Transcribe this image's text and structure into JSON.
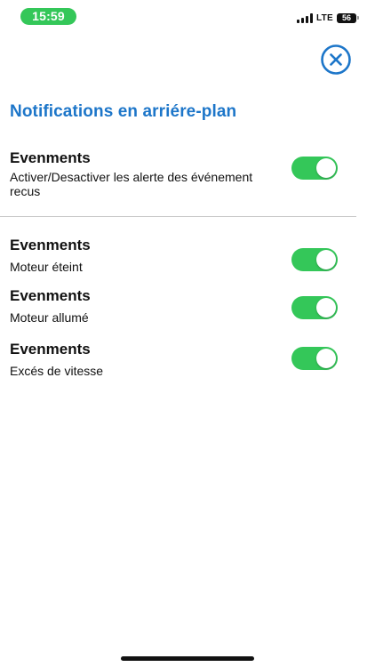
{
  "status_bar": {
    "time": "15:59",
    "network": "LTE",
    "battery": "56"
  },
  "header": {
    "title": "Notifications en arriére-plan",
    "close_icon": "close-circle-icon"
  },
  "settings": [
    {
      "title": "Evenments",
      "description": "Activer/Desactiver les alerte des événement recus",
      "enabled": true
    },
    {
      "title": "Evenments",
      "description": "Moteur éteint",
      "enabled": true
    },
    {
      "title": "Evenments",
      "description": "Moteur allumé",
      "enabled": true
    },
    {
      "title": "Evenments",
      "description": "Excés de vitesse",
      "enabled": true
    }
  ],
  "colors": {
    "accent": "#1d76c9",
    "toggle_on": "#34c759",
    "time_pill": "#34c759"
  }
}
